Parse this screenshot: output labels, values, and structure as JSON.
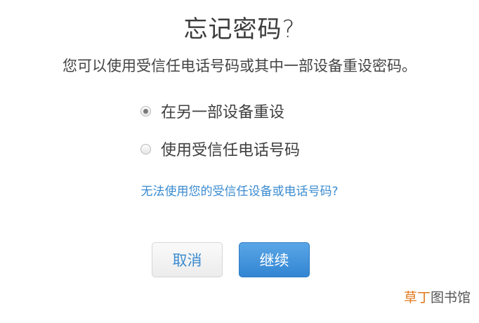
{
  "title": "忘记密码?",
  "subtitle": "您可以使用受信任电话号码或其中一部设备重设密码。",
  "options": [
    {
      "label": "在另一部设备重设",
      "selected": true
    },
    {
      "label": "使用受信任电话号码",
      "selected": false
    }
  ],
  "help_link": "无法使用您的受信任设备或电话号码?",
  "buttons": {
    "cancel": "取消",
    "continue": "继续"
  },
  "watermark": {
    "part_a": "草丁",
    "part_b": "图书馆"
  },
  "colors": {
    "link": "#3a8bd0",
    "primary": "#3285d3",
    "watermark_accent": "#e07a1c"
  }
}
